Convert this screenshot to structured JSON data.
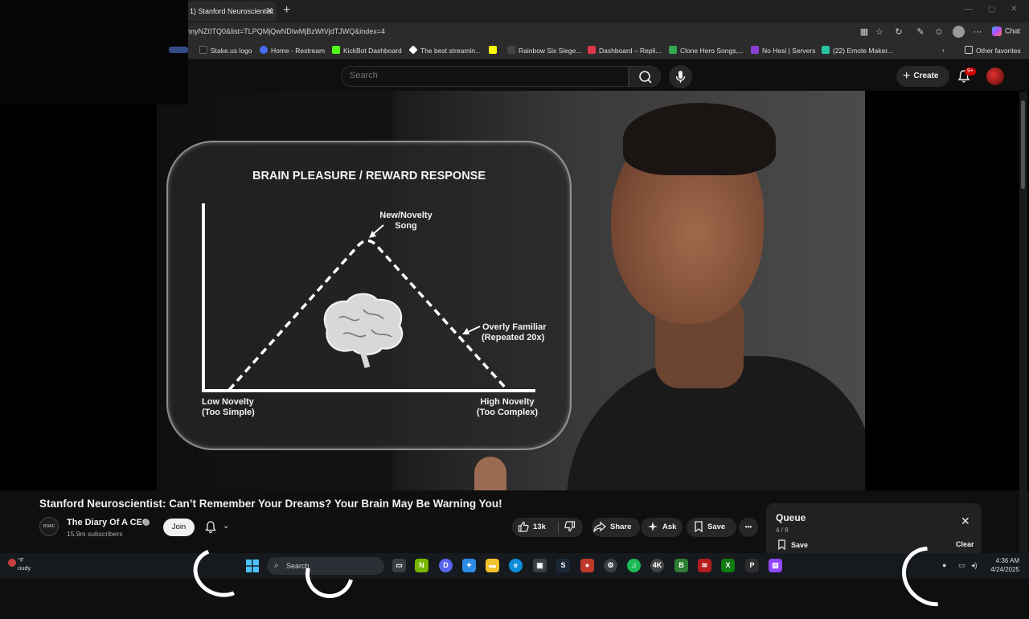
{
  "browser": {
    "tab_title": "1) Stanford Neuroscientist",
    "new_tab_symbol": "+",
    "url": "nnyNZ0TQ0&list=TLPQMjQwNDIwMjBzWtVjdTJWQ&index=4",
    "chat_label": "Chat",
    "favorites": [
      {
        "label": "Stake.us logo",
        "color": "#222222"
      },
      {
        "label": "Home - Restream",
        "color": "#4a6cf7"
      },
      {
        "label": "KickBot Dashboard",
        "color": "#53fc18"
      },
      {
        "label": "The best streamin...",
        "color": "#ffffff"
      },
      {
        "label": "",
        "color": "#fffc00"
      },
      {
        "label": "Rainbow Six Siege...",
        "color": "#444444"
      },
      {
        "label": "Dashboard – Repli...",
        "color": "#e0364c"
      },
      {
        "label": "Clone Hero Songs,...",
        "color": "#34a853"
      },
      {
        "label": "No Hesi | Servers",
        "color": "#8b3fd9"
      },
      {
        "label": "(22) Emote Maker...",
        "color": "#26c6a0"
      }
    ],
    "other_favorites": "Other favorites"
  },
  "youtube": {
    "search_placeholder": "Search",
    "create_label": "Create",
    "notification_badge": "9+",
    "video_title": "Stanford Neuroscientist: Can’t Remember Your Dreams? Your Brain May Be Warning You!",
    "channel_name": "The Diary Of A CEO",
    "channel_avatar_text": "DOAC",
    "subscribers": "15.9m subscribers",
    "join_label": "Join",
    "like_count": "13k",
    "share_label": "Share",
    "ask_label": "Ask",
    "save_label": "Save",
    "more_symbol": "•••",
    "queue": {
      "title": "Queue",
      "position": "4 / 8",
      "save_label": "Save",
      "clear_label": "Clear"
    }
  },
  "video_graphic": {
    "title": "BRAIN PLEASURE / REWARD RESPONSE",
    "peak_label_line1": "New/Novelty",
    "peak_label_line2": "Song",
    "right_label_line1": "Overly Familiar",
    "right_label_line2": "(Repeated 20x)",
    "x_left_line1": "Low Novelty",
    "x_left_line2": "(Too Simple)",
    "x_right_line1": "High Novelty",
    "x_right_line2": "(Too Complex)"
  },
  "taskbar": {
    "weather_temp": "°F",
    "weather_desc": "oudy",
    "search_label": "Search",
    "time": "4:36 AM",
    "date": "4/24/2025"
  },
  "colors": {
    "youtube_bg": "#0f0f0f",
    "pill_bg": "#272727",
    "notification_red": "#cc0000"
  }
}
